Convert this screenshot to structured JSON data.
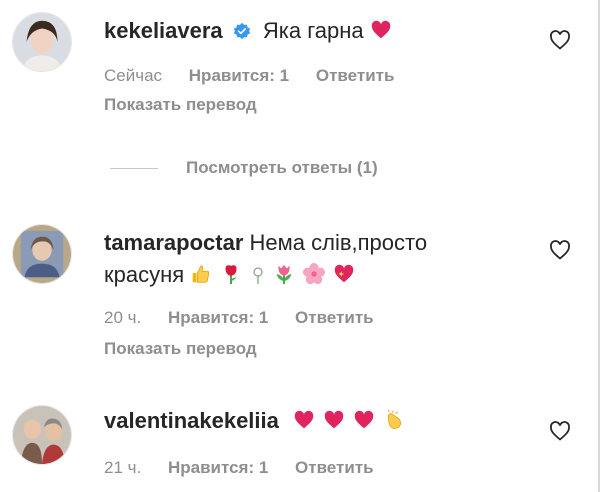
{
  "colors": {
    "text": "#262626",
    "muted": "#8e8e8e",
    "verified": "#3897f0",
    "heart": "#e0245e"
  },
  "comments": [
    {
      "username": "kekeliavera",
      "verified": true,
      "text": "Яка гарна",
      "emoji": [
        "red-heart"
      ],
      "time": "Сейчас",
      "likes": "Нравится: 1",
      "reply": "Ответить",
      "translate": "Показать перевод",
      "view_replies": "Посмотреть ответы (1)"
    },
    {
      "username": "tamarapoctar",
      "verified": false,
      "text_line1": "Нема слів,просто",
      "text_line2": "красуня",
      "emoji": [
        "thumbs-up",
        "rose",
        "small-flower",
        "tulip",
        "cherry-blossom",
        "heart-with-sparkles"
      ],
      "time": "20 ч.",
      "likes": "Нравится: 1",
      "reply": "Ответить",
      "translate": "Показать перевод"
    },
    {
      "username": "valentinakekeliia",
      "verified": false,
      "emoji": [
        "red-heart",
        "red-heart",
        "red-heart",
        "clapping-hands"
      ],
      "time": "21 ч.",
      "likes": "Нравится: 1",
      "reply": "Ответить"
    }
  ]
}
